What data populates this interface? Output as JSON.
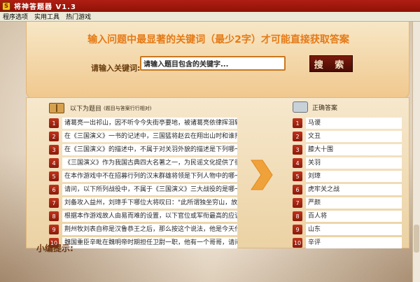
{
  "window": {
    "app_icon_letter": "S",
    "title": "将神答题器  V1.3"
  },
  "menu": [
    "程序选项",
    "实用工具",
    "热门游戏"
  ],
  "search": {
    "notice": "输入问题中最显著的关键词（最少2字）才可能直接获取答案",
    "label": "请输入关键词:",
    "input_value": "请输入题目包含的关键字...",
    "button": "搜 索"
  },
  "questions_header": {
    "title": "以下为题目",
    "subtitle": "(题目与答案行行相对)"
  },
  "answers_header": {
    "title": "正确答案"
  },
  "rows": [
    {
      "num": "1",
      "question": "诸葛亮一出祁山，因不听令今失街亭要地，被诸葛亮依律挥泪斩",
      "answer": "马谡"
    },
    {
      "num": "2",
      "question": "在《三国演义》一书的记述中，三国猛将赵云在翔出山时和谁打",
      "answer": "文丑"
    },
    {
      "num": "3",
      "question": "在《三国演义》的描述中，不属于对关羽外貌的描述是下列哪一",
      "answer": "膝大十围"
    },
    {
      "num": "4",
      "question": "《三国演义》作为我国古典四大名著之一，为民谣文化提供了很",
      "answer": "关羽"
    },
    {
      "num": "5",
      "question": "在本作游戏中不在招募行列的汉末群雄将领是下列人物中的哪一",
      "answer": "刘璋"
    },
    {
      "num": "6",
      "question": "请问，以下所列战役中，不属于《三国演义》三大战役的是哪一",
      "answer": "虎牢关之战"
    },
    {
      "num": "7",
      "question": "刘备攻入益州，刘璋手下哪位大将叹曰：\"此所谓独坐穷山，放",
      "answer": "严颜"
    },
    {
      "num": "8",
      "question": "根据本作游戏故人由易而难的设置，以下官位或军衔最高的应该",
      "answer": "百人将"
    },
    {
      "num": "9",
      "question": "荆州牧刘表自称是汉鲁恭王之后，那么按这个说法，他是今天什",
      "answer": "山东"
    },
    {
      "num": "10",
      "question": "魏国重臣辛毗在魏明帝时期担任卫尉一职，他有一个哥哥，请问",
      "answer": "辛评"
    }
  ],
  "tip": {
    "label": "小编提示:"
  },
  "colors": {
    "accent_orange": "#e57a16",
    "titlebar_red": "#b01e12",
    "number_red": "#c0331c"
  }
}
